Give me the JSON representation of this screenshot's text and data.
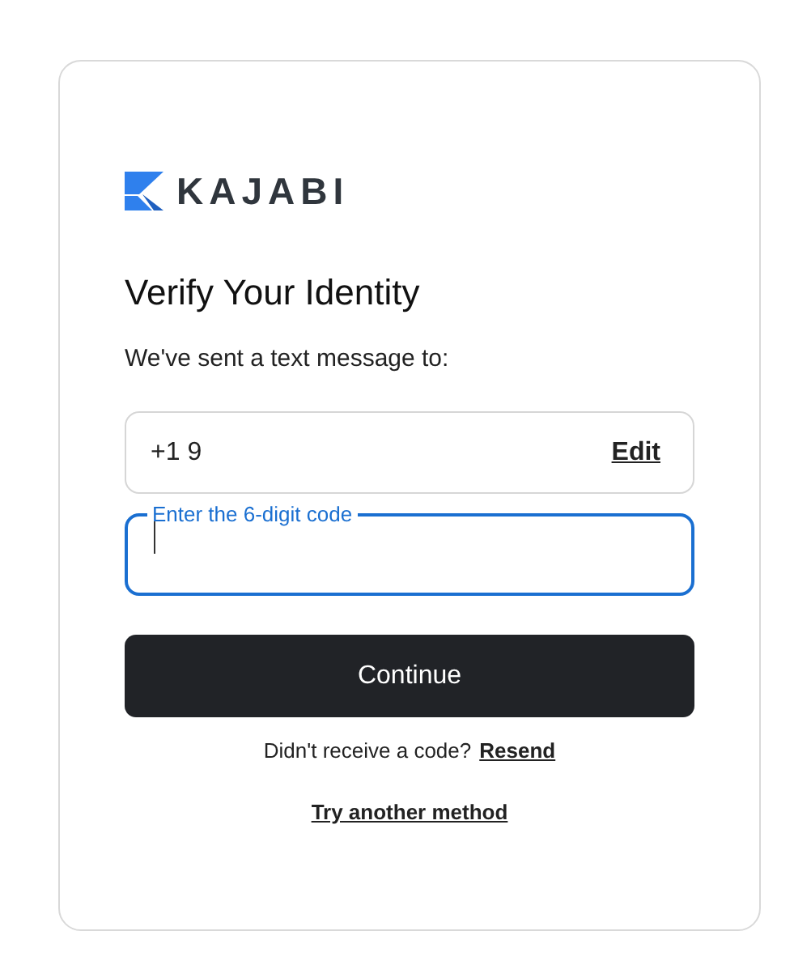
{
  "brand": {
    "name": "KAJABI"
  },
  "title": "Verify Your Identity",
  "message": "We've sent a text message to:",
  "phone_field": {
    "value": "+1 9",
    "action": "Edit"
  },
  "code_field": {
    "label": "Enter the 6-digit code",
    "focused": true
  },
  "submit_button": "Continue",
  "resend": {
    "text": "Didn't receive a code?",
    "link": "Resend"
  },
  "alternate_link": "Try another method"
}
